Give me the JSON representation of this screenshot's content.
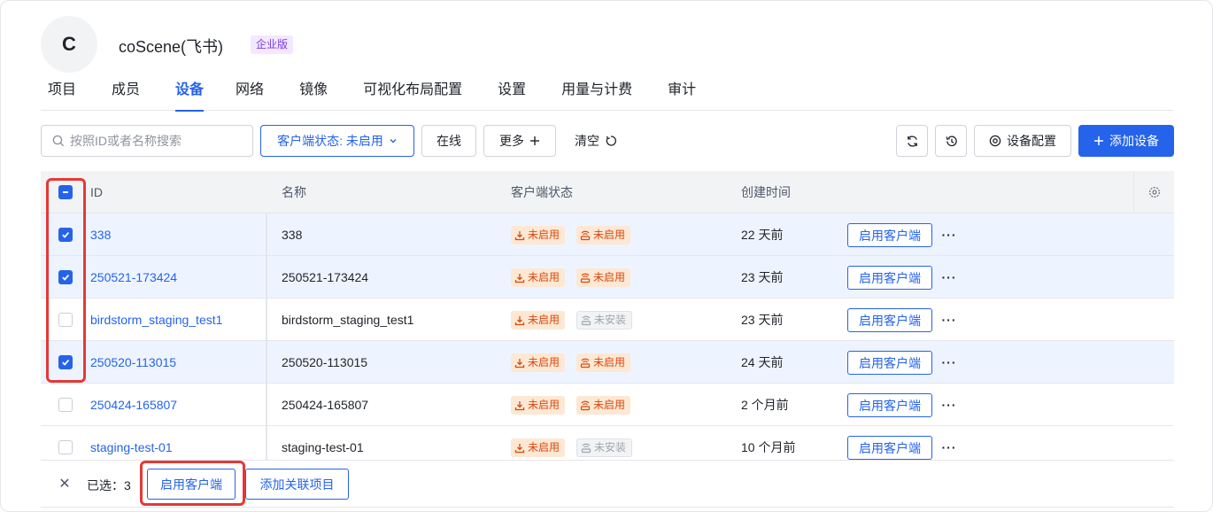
{
  "org": {
    "avatar_letter": "C",
    "name": "coScene(飞书)",
    "edition_badge": "企业版"
  },
  "tabs": [
    {
      "label": "项目",
      "active": false
    },
    {
      "label": "成员",
      "active": false
    },
    {
      "label": "设备",
      "active": true
    },
    {
      "label": "网络",
      "active": false
    },
    {
      "label": "镜像",
      "active": false
    },
    {
      "label": "可视化布局配置",
      "active": false
    },
    {
      "label": "设置",
      "active": false
    },
    {
      "label": "用量与计费",
      "active": false
    },
    {
      "label": "审计",
      "active": false
    }
  ],
  "toolbar": {
    "search_placeholder": "按照ID或者名称搜索",
    "filter_label": "客户端状态: 未启用",
    "online_label": "在线",
    "more_label": "更多",
    "clear_label": "清空",
    "device_config_label": "设备配置",
    "add_device_label": "添加设备"
  },
  "table": {
    "headers": {
      "id": "ID",
      "name": "名称",
      "client_status": "客户端状态",
      "created": "创建时间"
    },
    "rows": [
      {
        "id": "338",
        "name": "338",
        "status1": "未启用",
        "status2": "未启用",
        "status2_kind": "warn",
        "created": "22 天前",
        "action": "启用客户端",
        "selected": true
      },
      {
        "id": "250521-173424",
        "name": "250521-173424",
        "status1": "未启用",
        "status2": "未启用",
        "status2_kind": "warn",
        "created": "23 天前",
        "action": "启用客户端",
        "selected": true
      },
      {
        "id": "birdstorm_staging_test1",
        "name": "birdstorm_staging_test1",
        "status1": "未启用",
        "status2": "未安装",
        "status2_kind": "gray",
        "created": "23 天前",
        "action": "启用客户端",
        "selected": false
      },
      {
        "id": "250520-113015",
        "name": "250520-113015",
        "status1": "未启用",
        "status2": "未启用",
        "status2_kind": "warn",
        "created": "24 天前",
        "action": "启用客户端",
        "selected": true
      },
      {
        "id": "250424-165807",
        "name": "250424-165807",
        "status1": "未启用",
        "status2": "未启用",
        "status2_kind": "warn",
        "created": "2 个月前",
        "action": "启用客户端",
        "selected": false
      },
      {
        "id": "staging-test-01",
        "name": "staging-test-01",
        "status1": "未启用",
        "status2": "未安装",
        "status2_kind": "gray",
        "created": "10 个月前",
        "action": "启用客户端",
        "selected": false
      }
    ]
  },
  "bottombar": {
    "selected_text": "已选：3",
    "enable_client_label": "启用客户端",
    "add_project_label": "添加关联项目"
  },
  "colors": {
    "accent": "#2563eb",
    "warn_bg": "#fde8d4",
    "warn_text": "#d9480f",
    "highlight": "#e53935"
  }
}
